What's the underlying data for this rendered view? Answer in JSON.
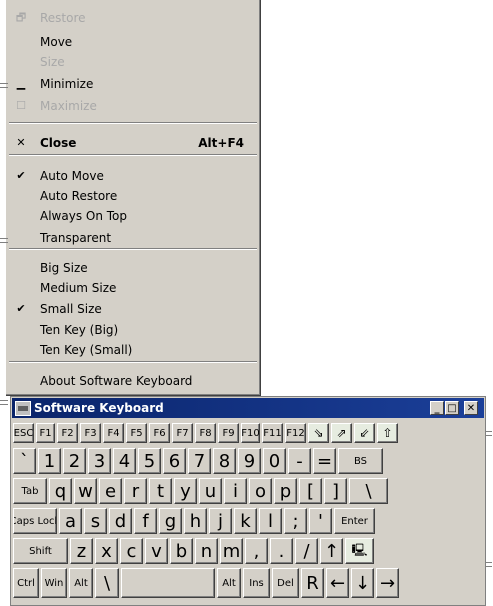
{
  "menu": {
    "items": [
      {
        "label": "Restore",
        "icon": "restore-icon",
        "glyph": "🗗",
        "disabled": true
      },
      {
        "label": "Move",
        "icon": "",
        "glyph": "",
        "disabled": false
      },
      {
        "label": "Size",
        "icon": "",
        "glyph": "",
        "disabled": true
      },
      {
        "label": "Minimize",
        "icon": "minimize-icon",
        "glyph": "▁",
        "disabled": false
      },
      {
        "label": "Maximize",
        "icon": "maximize-icon",
        "glyph": "☐",
        "disabled": true
      },
      {
        "label": "Close",
        "icon": "close-icon",
        "glyph": "✕",
        "shortcut": "Alt+F4",
        "bold": true
      },
      {
        "label": "Auto Move",
        "checked": true
      },
      {
        "label": "Auto Restore",
        "checked": false
      },
      {
        "label": "Always On Top",
        "checked": false
      },
      {
        "label": "Transparent",
        "checked": false
      },
      {
        "label": "Big Size",
        "checked": false
      },
      {
        "label": "Medium Size",
        "checked": false
      },
      {
        "label": "Small Size",
        "checked": true
      },
      {
        "label": "Ten Key (Big)",
        "checked": false
      },
      {
        "label": "Ten Key (Small)",
        "checked": false
      },
      {
        "label": "About Software Keyboard",
        "checked": false
      }
    ],
    "check_glyph": "✔"
  },
  "window": {
    "title": "Software Keyboard",
    "titlebar_color": "#0a246a",
    "min_glyph": "_",
    "max_glyph": "□",
    "close_glyph": "✕"
  },
  "keyboard": {
    "row1": [
      "ESC",
      "F1",
      "F2",
      "F3",
      "F4",
      "F5",
      "F6",
      "F7",
      "F8",
      "F9",
      "F10",
      "F11",
      "F12",
      "⇘",
      "⇗",
      "⇙",
      "⇧"
    ],
    "row2": [
      "`",
      "1",
      "2",
      "3",
      "4",
      "5",
      "6",
      "7",
      "8",
      "9",
      "0",
      "-",
      "=",
      "BS"
    ],
    "row3": [
      "Tab",
      "q",
      "w",
      "e",
      "r",
      "t",
      "y",
      "u",
      "i",
      "o",
      "p",
      "[",
      "]",
      "\\"
    ],
    "row4": [
      "Caps Lock",
      "a",
      "s",
      "d",
      "f",
      "g",
      "h",
      "j",
      "k",
      "l",
      ";",
      "'",
      "Enter"
    ],
    "row5": [
      "Shift",
      "z",
      "x",
      "c",
      "v",
      "b",
      "n",
      "m",
      ",",
      ".",
      "/",
      "↑",
      "🖳"
    ],
    "row6": [
      "Ctrl",
      "Win",
      "Alt",
      "\\",
      "",
      "Alt",
      "Ins",
      "Del",
      "R",
      "←",
      "↓",
      "→"
    ]
  }
}
